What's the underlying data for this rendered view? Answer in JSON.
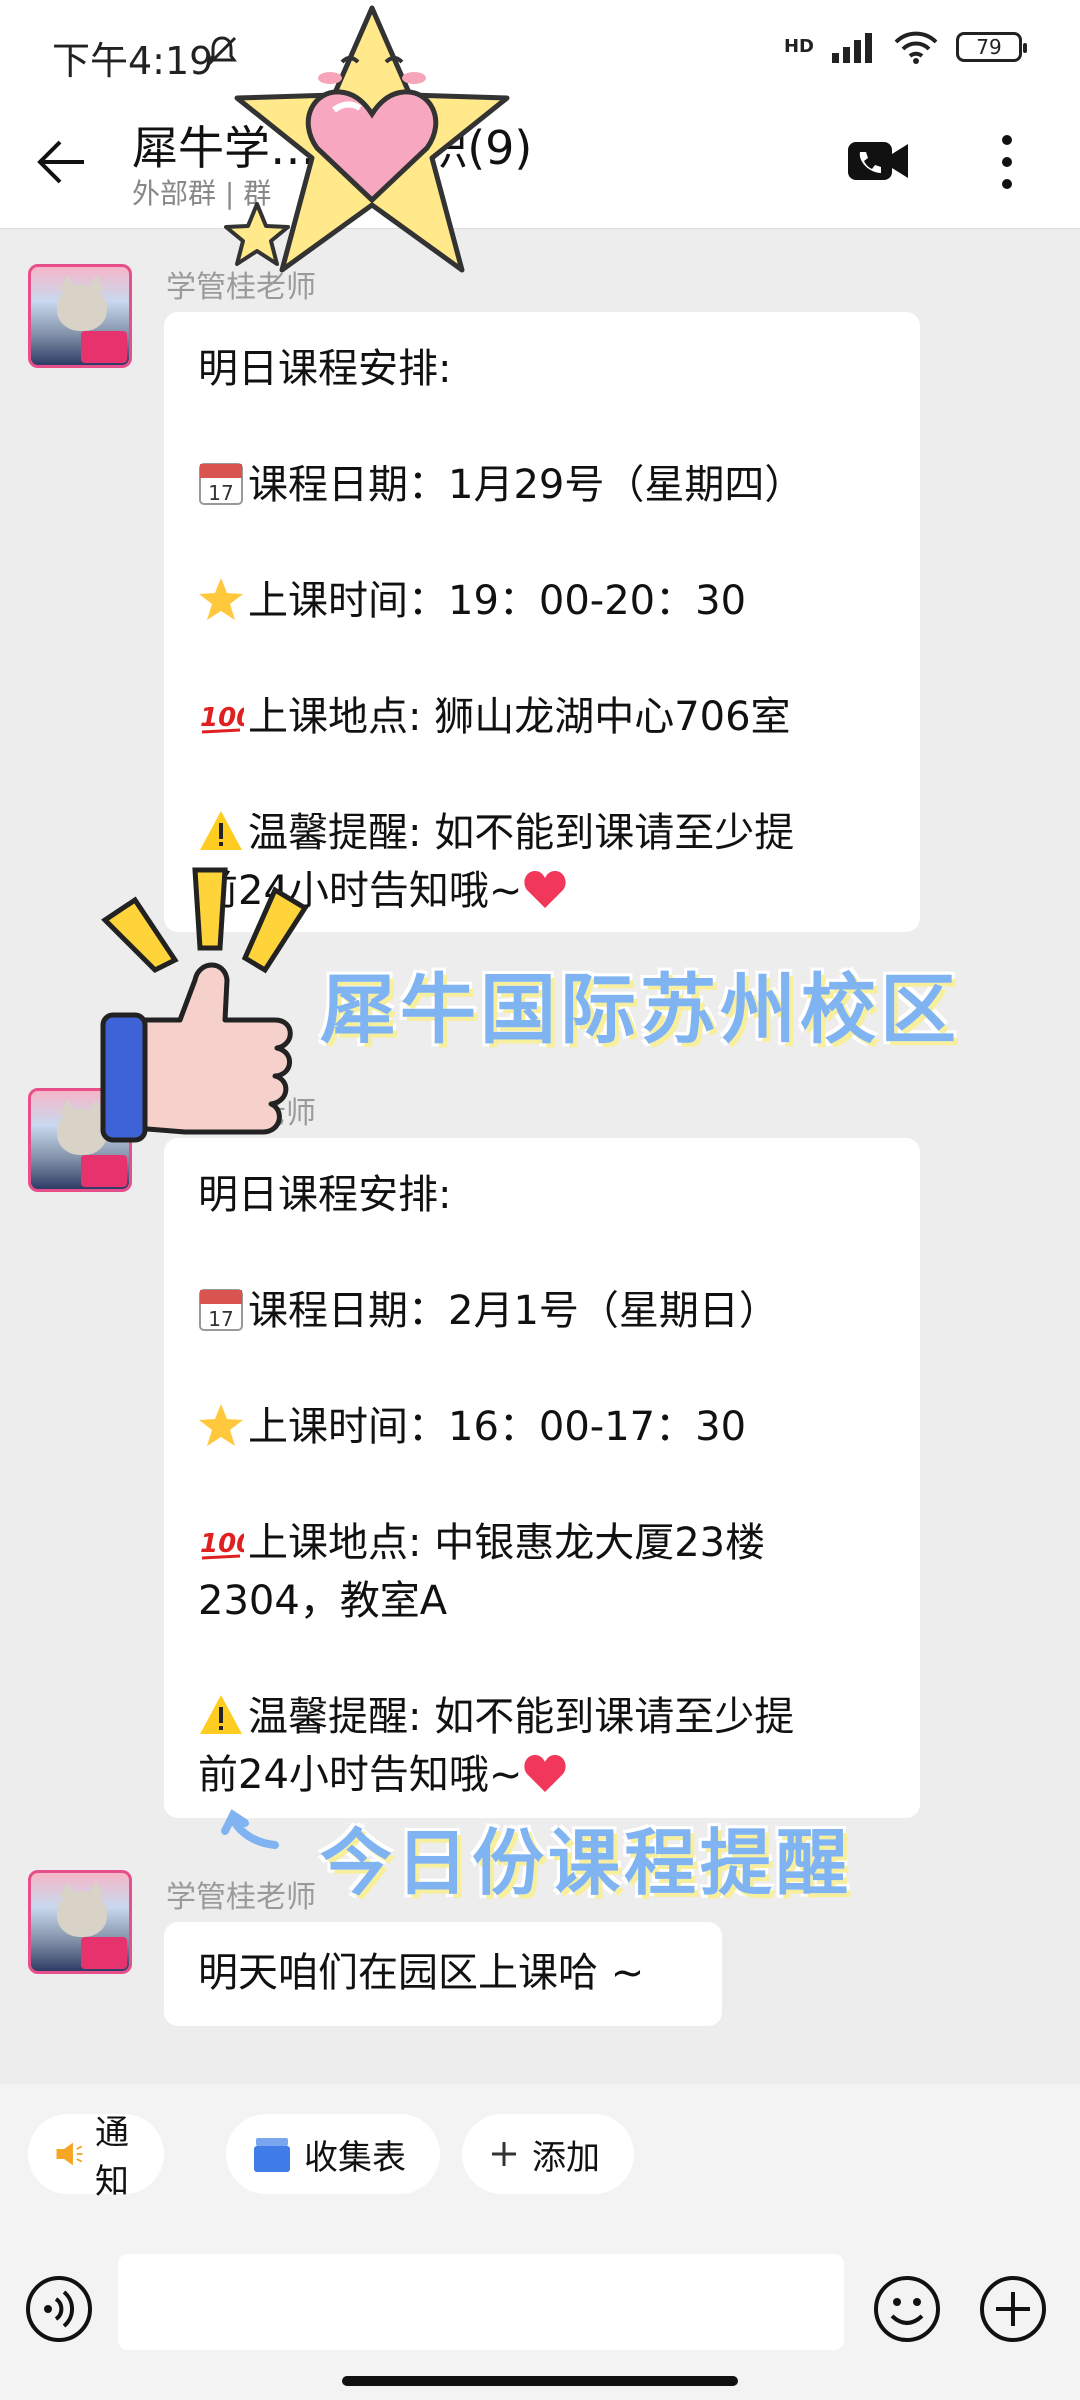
{
  "status_bar": {
    "time": "下午4:19",
    "network": "HD",
    "battery": "79"
  },
  "header": {
    "title": "犀牛学…AP微积(9)",
    "subtitle": "外部群 | 群"
  },
  "messages": [
    {
      "sender": "学管桂老师",
      "lines": [
        "明日课程安排:",
        "",
        "课程日期：1月29号（星期四）",
        "",
        "上课时间：19：00-20：30",
        "",
        "上课地点: 狮山龙湖中心706室",
        "",
        "温馨提醒: 如不能到课请至少提",
        "前24小时告知哦~"
      ]
    },
    {
      "sender": "学管桂老师",
      "lines": [
        "明日课程安排:",
        "",
        "课程日期：2月1号（星期日）",
        "",
        "上课时间：16：00-17：30",
        "",
        "上课地点: 中银惠龙大厦23楼",
        "2304，教室A",
        "",
        "温馨提醒: 如不能到课请至少提",
        "前24小时告知哦~"
      ]
    },
    {
      "sender": "学管桂老师",
      "lines": [
        "明天咱们在园区上课哈 ~"
      ]
    }
  ],
  "overlays": {
    "campus": "犀牛国际苏州校区",
    "reminder": "今日份课程提醒"
  },
  "toolbar": {
    "notice": "通知",
    "form": "收集表",
    "add": "添加"
  },
  "icons": {
    "calendar": "calendar-icon",
    "star": "star-icon",
    "hundred": "hundred-points-icon",
    "warning": "warning-icon",
    "heart": "heart-icon"
  }
}
